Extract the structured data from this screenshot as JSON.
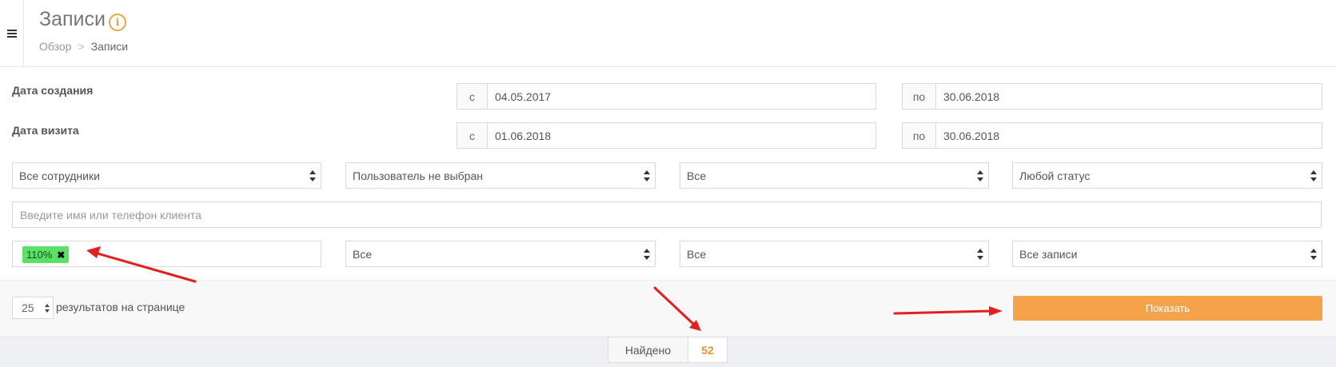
{
  "header": {
    "title": "Записи",
    "breadcrumb": {
      "home": "Обзор",
      "separator": ">",
      "current": "Записи"
    }
  },
  "filters": {
    "created": {
      "label": "Дата создания",
      "from_addon": "с",
      "from_value": "04.05.2017",
      "to_addon": "по",
      "to_value": "30.06.2018"
    },
    "visit": {
      "label": "Дата визита",
      "from_addon": "с",
      "from_value": "01.06.2018",
      "to_addon": "по",
      "to_value": "30.06.2018"
    },
    "selects_row1": [
      "Все сотрудники",
      "Пользователь не выбран",
      "Все",
      "Любой статус"
    ],
    "client_search": {
      "placeholder": "Введите имя или телефон клиента"
    },
    "tag": {
      "label": "110%",
      "remove_icon": "close-icon"
    },
    "selects_row2": [
      "Все",
      "Все",
      "Все записи"
    ]
  },
  "footer": {
    "per_page_value": "25",
    "per_page_text": "результатов на странице",
    "show_button": "Показать"
  },
  "results": {
    "found_label": "Найдено",
    "found_count": "52"
  },
  "colors": {
    "accent": "#f5a34b",
    "tag": "#58e164",
    "annotation_arrow": "#e32020"
  }
}
